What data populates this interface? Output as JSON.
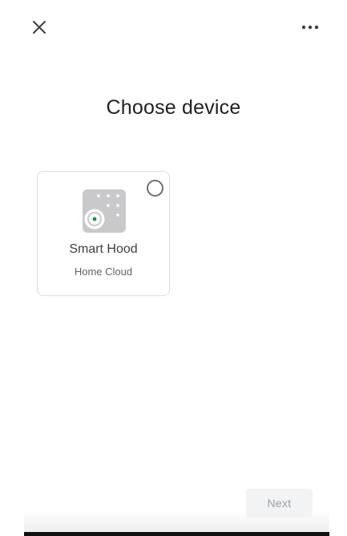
{
  "header": {
    "close_icon": "close-icon",
    "more_icon": "more-horizontal-icon",
    "title": "Choose device"
  },
  "devices": [
    {
      "name": "Smart Hood",
      "provider": "Home Cloud",
      "icon": "smart-hood-device-icon",
      "selected": false
    }
  ],
  "footer": {
    "next_label": "Next",
    "next_enabled": false
  },
  "colors": {
    "background": "#ffffff",
    "title_text": "#202124",
    "card_border": "#dadce0",
    "device_icon_bg": "#c9c9cb",
    "device_icon_dot": "#1e8e3e",
    "next_button_bg": "#f1f3f4",
    "next_button_text": "#9aa0a6"
  }
}
